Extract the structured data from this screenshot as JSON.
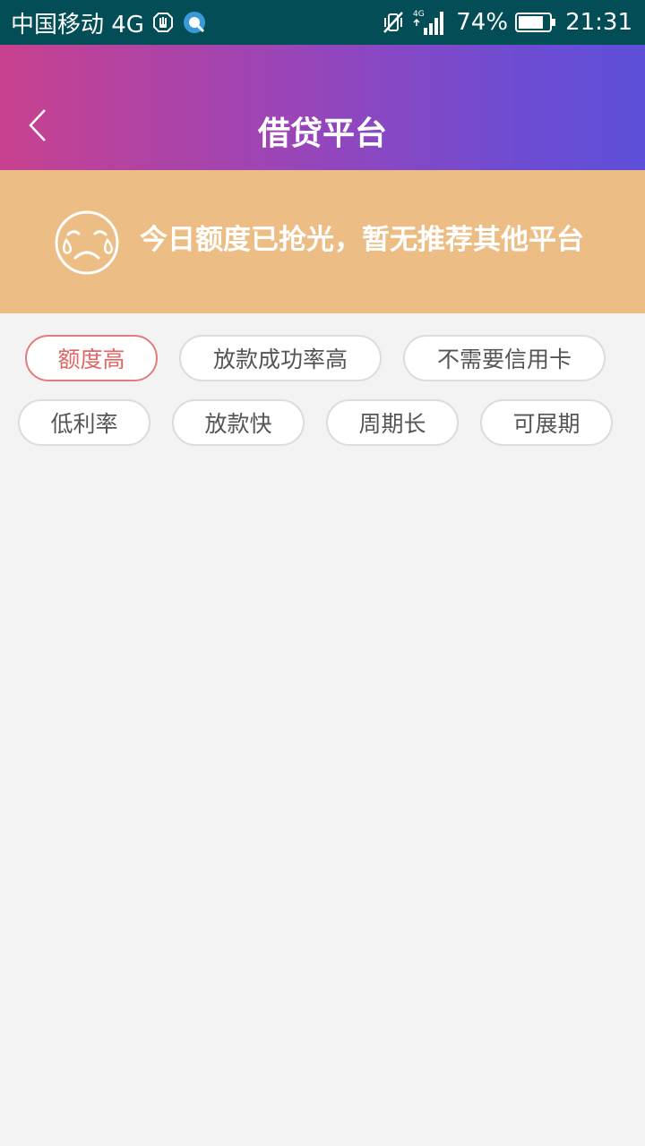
{
  "status_bar": {
    "carrier": "中国移动 4G",
    "network_small": "4G",
    "battery_percent": "74%",
    "time": "21:31"
  },
  "header": {
    "title": "借贷平台"
  },
  "notice": {
    "message": "今日额度已抢光，暂无推荐其他平台"
  },
  "tags": [
    {
      "label": "额度高",
      "active": true
    },
    {
      "label": "放款成功率高",
      "active": false
    },
    {
      "label": "不需要信用卡",
      "active": false
    },
    {
      "label": "低利率",
      "active": false
    },
    {
      "label": "放款快",
      "active": false
    },
    {
      "label": "周期长",
      "active": false
    },
    {
      "label": "可展期",
      "active": false
    }
  ],
  "colors": {
    "status_bar_bg": "#024d56",
    "header_gradient_start": "#c8418f",
    "header_gradient_end": "#5d4fd8",
    "notice_bg": "#ecbd85",
    "active_tag": "#e06565",
    "page_bg": "#f3f3f3"
  }
}
